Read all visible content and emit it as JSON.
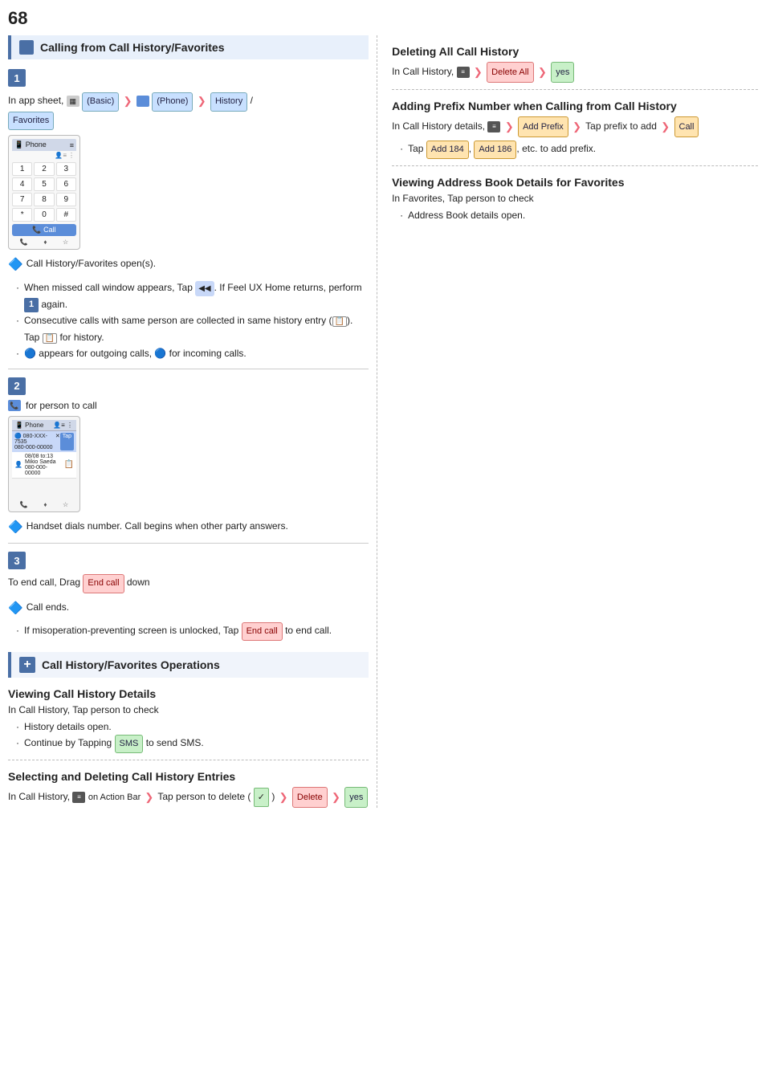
{
  "page": {
    "number": "68",
    "left_section_header": "Calling from Call History/Favorites",
    "step1": {
      "label": "1",
      "text1": "In app sheet,",
      "basic_badge": "(Basic)",
      "phone_badge": "(Phone)",
      "history_badge": "History",
      "slash": "/",
      "favorites_badge": "Favorites"
    },
    "step1_note": "Call History/Favorites open(s).",
    "step1_bullets": [
      "When missed call window appears, Tap    . If Feel UX Home returns, perform   again.",
      "Consecutive calls with same person are collected in same history entry (   ). Tap    for history.",
      "  appears for outgoing calls,   for incoming calls."
    ],
    "step2": {
      "label": "2",
      "text": "for person to call"
    },
    "step2_note": "Handset dials number. Call begins when other party answers.",
    "step3": {
      "label": "3",
      "text1": "To end call, Drag",
      "end_call_badge": "End call",
      "text2": "down"
    },
    "step3_note": "Call ends.",
    "step3_bullets": [
      "If misoperation-preventing screen is unlocked, Tap End call  to end call."
    ],
    "ops_header": "Call History/Favorites Operations",
    "viewing_history_title": "Viewing Call History Details",
    "viewing_history_text": "In Call History, Tap person to check",
    "viewing_history_bullets": [
      "History details open.",
      "Continue by Tapping  SMS  to send SMS."
    ],
    "selecting_title": "Selecting and Deleting Call History Entries",
    "selecting_text1": "In Call History,",
    "selecting_action_badge": "on Action Bar",
    "selecting_text2": "Tap person to delete (",
    "checkmark": "✓",
    "selecting_badges": [
      "Delete",
      "yes"
    ]
  },
  "right": {
    "deleting_title": "Deleting All Call History",
    "deleting_text": "In Call History,",
    "deleting_badges": [
      "Delete All",
      "yes"
    ],
    "adding_title": "Adding Prefix Number when Calling from Call History",
    "adding_text1": "In Call History details,",
    "adding_badge1": "Add Prefix",
    "adding_text2": "Tap prefix to add",
    "adding_badge2": "Call",
    "adding_bullets": [
      "Tap  Add 184 ,  Add 186 , etc. to add prefix."
    ],
    "viewing_fav_title": "Viewing Address Book Details for Favorites",
    "viewing_fav_text": "In Favorites, Tap person to check",
    "viewing_fav_bullets": [
      "Address Book details open."
    ]
  },
  "phone_grid_numbers": [
    "1",
    "2",
    "3",
    "4",
    "5",
    "6",
    "7",
    "8",
    "9",
    "*",
    "0",
    "#"
  ],
  "phone_bottom_labels": [
    "",
    "♦♦",
    "☆"
  ],
  "labels": {
    "call": "Call",
    "sms": "SMS",
    "end_call": "End call",
    "add_prefix": "Add Prefix",
    "add184": "Add 184",
    "add186": "Add 186",
    "delete_all": "Delete All",
    "delete": "Delete",
    "yes": "yes"
  }
}
